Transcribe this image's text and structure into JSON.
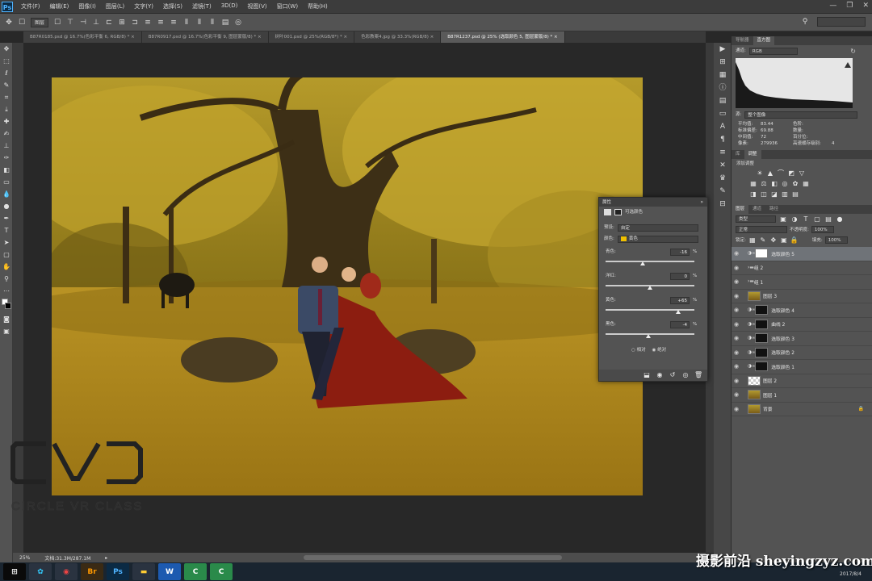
{
  "app": {
    "logo": "Ps"
  },
  "menu": [
    "文件(F)",
    "编辑(E)",
    "图像(I)",
    "图层(L)",
    "文字(Y)",
    "选择(S)",
    "滤镜(T)",
    "3D(D)",
    "视图(V)",
    "窗口(W)",
    "帮助(H)"
  ],
  "options": {
    "mode": "图层"
  },
  "tabs": [
    {
      "label": "B87R0185.psd @ 16.7%(色彩平衡 6, RGB/8) *",
      "active": false
    },
    {
      "label": "B87R0917.psd @ 16.7%(色彩平衡 9, 图层蒙版/8) *",
      "active": false
    },
    {
      "label": "树叶001.psd @ 25%(RGB/8*) *",
      "active": false
    },
    {
      "label": "色彩教案4.jpg @ 33.3%(RGB/8)",
      "active": false
    },
    {
      "label": "B87R1237.psd @ 25% (选取颜色 5, 图层蒙版/8) *",
      "active": true
    }
  ],
  "status": {
    "zoom": "25%",
    "doc": "文档:31.3M/287.1M"
  },
  "histogram": {
    "tabs": [
      "导航器",
      "直方图"
    ],
    "channel_label": "通道:",
    "channel": "RGB",
    "source_label": "源:",
    "source": "整个图像",
    "stats": [
      {
        "k": "平均值:",
        "v": "83.44",
        "k2": "色阶:",
        "v2": ""
      },
      {
        "k": "标准偏差:",
        "v": "69.88",
        "k2": "数量:",
        "v2": ""
      },
      {
        "k": "中间值:",
        "v": "72",
        "k2": "百分位:",
        "v2": ""
      },
      {
        "k": "像素:",
        "v": "279936",
        "k2": "高速缓存级别:",
        "v2": "4"
      }
    ]
  },
  "adjustments": {
    "tabs": [
      "库",
      "调整"
    ],
    "title": "添加调整"
  },
  "layers_panel": {
    "tabs": [
      "图层",
      "通道",
      "路径"
    ],
    "filter": "类型",
    "blend": "正常",
    "opacity_label": "不透明度:",
    "opacity": "100%",
    "lock_label": "锁定:",
    "fill_label": "填充:",
    "fill": "100%",
    "layers": [
      {
        "name": "选取颜色 5",
        "kind": "adj",
        "selected": true,
        "mask": "white"
      },
      {
        "name": "组 2",
        "kind": "group"
      },
      {
        "name": "组 1",
        "kind": "group"
      },
      {
        "name": "图层 3",
        "kind": "pixel"
      },
      {
        "name": "选取颜色 4",
        "kind": "adj",
        "mask": "black"
      },
      {
        "name": "曲线 2",
        "kind": "adj",
        "mask": "black"
      },
      {
        "name": "选取颜色 3",
        "kind": "adj",
        "mask": "black"
      },
      {
        "name": "选取颜色 2",
        "kind": "adj",
        "mask": "black"
      },
      {
        "name": "选取颜色 1",
        "kind": "adj",
        "mask": "black"
      },
      {
        "name": "图层 2",
        "kind": "blank"
      },
      {
        "name": "图层 1",
        "kind": "pixel"
      },
      {
        "name": "背景",
        "kind": "pixel",
        "locked": true
      }
    ]
  },
  "properties": {
    "title": "属性",
    "subtitle": "可选颜色",
    "preset_label": "预设:",
    "preset": "自定",
    "color_label": "颜色:",
    "color": "黄色",
    "color_hex": "#f0c000",
    "sliders": [
      {
        "label": "青色:",
        "value": "-16",
        "pct": "%",
        "level": 0.42
      },
      {
        "label": "洋红:",
        "value": "0",
        "pct": "%",
        "level": 0.5
      },
      {
        "label": "黄色:",
        "value": "+65",
        "pct": "%",
        "level": 0.82
      },
      {
        "label": "黑色:",
        "value": "-4",
        "pct": "%",
        "level": 0.48
      }
    ],
    "method_relative": "相对",
    "method_absolute": "绝对",
    "method_selected": "绝对"
  },
  "overlay": {
    "logo_text": "CIRCLE VR CLASS",
    "watermark": "摄影前沿 sheyingzyz.com",
    "date": "2017/8/4"
  }
}
